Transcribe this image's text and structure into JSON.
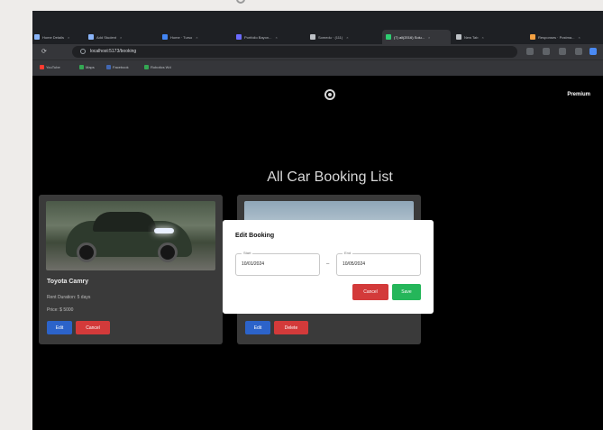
{
  "browser": {
    "tabs": [
      {
        "label": "Home Details",
        "color": "#8ab4f8"
      },
      {
        "label": "Add Student",
        "color": "#8ab4f8"
      },
      {
        "label": "Home · Turso",
        "color": "#4285f4"
      },
      {
        "label": "Portfolio Bayon...",
        "color": "#6b6bff"
      },
      {
        "label": "Somedu · (111)",
        "color": "#bdc1c6"
      },
      {
        "label": "(7) all(2016) Solu...",
        "color": "#2ecc71"
      },
      {
        "label": "New Tab",
        "color": "#bdc1c6"
      },
      {
        "label": "Responses · Postma...",
        "color": "#f4a142"
      }
    ],
    "url": "localhost:5173/booking",
    "bookmarks": [
      {
        "label": "YouTube",
        "color": "#ff3b30"
      },
      {
        "label": "Maps",
        "color": "#34a853"
      },
      {
        "label": "Facebook",
        "color": "#4267b2"
      },
      {
        "label": "Robotics Wd",
        "color": "#34a853"
      }
    ]
  },
  "header": {
    "nav_link": "Premium"
  },
  "page": {
    "title": "All Car Booking List"
  },
  "bookings": [
    {
      "name": "Toyota Camry",
      "duration": "Rent Duration: 5 days",
      "price": "Price: $ 5000",
      "edit_label": "Edit",
      "cancel_label": "Cancel"
    },
    {
      "edit_label": "Edit",
      "delete_label": "Delete"
    }
  ],
  "modal": {
    "title": "Edit Booking",
    "start_label": "Start",
    "start_value": "10/01/2024",
    "end_label": "End",
    "end_value": "10/05/2024",
    "separator": "–",
    "cancel_label": "Cancel",
    "save_label": "Save"
  }
}
